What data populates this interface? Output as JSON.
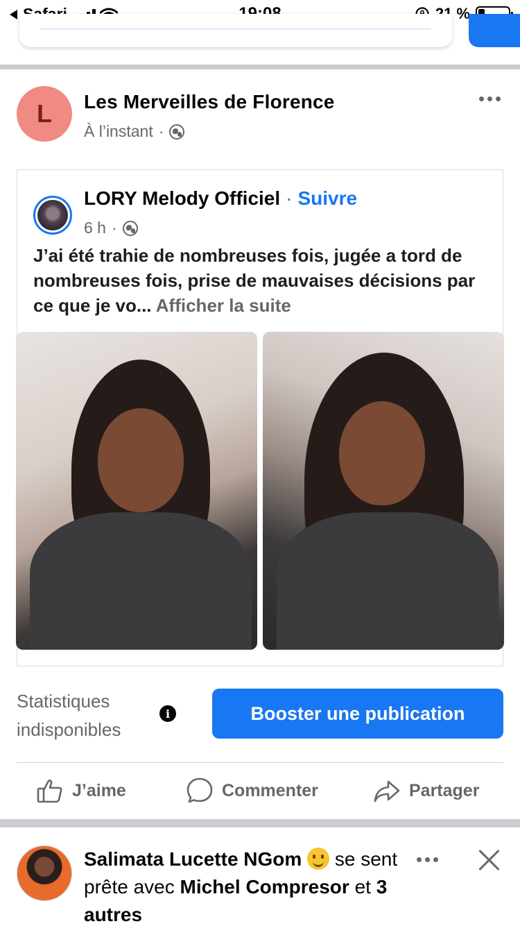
{
  "status_bar": {
    "back_app": "Safari",
    "time": "19:08",
    "battery_text": "21 %",
    "battery_level": 0.21
  },
  "post": {
    "page_name": "Les Merveilles de Florence",
    "avatar_letter": "L",
    "time": "À l’instant",
    "meta_separator": "·",
    "shared": {
      "author": "LORY Melody Officiel",
      "separator": "·",
      "follow_label": "Suivre",
      "time": "6 h",
      "meta_separator": "·",
      "text": "J’ai été trahie de nombreuses fois, jugée a tord de nombreuses fois, prise de mauvaises décisions par ce que je vo...",
      "see_more": "Afficher la suite"
    },
    "stats_label": "Statistiques indisponibles",
    "boost_label": "Booster une publication",
    "actions": {
      "like": "J’aime",
      "comment": "Commenter",
      "share": "Partager"
    }
  },
  "next_post": {
    "author": "Salimata Lucette NGom",
    "feeling_text": "se sent prête avec",
    "tagged": "Michel Compresor",
    "and_text": "et",
    "others": "3 autres"
  },
  "colors": {
    "accent": "#1877f2",
    "secondary_text": "#65676b",
    "separator": "#c9ccd1",
    "avatar_bg": "#f08a82"
  }
}
